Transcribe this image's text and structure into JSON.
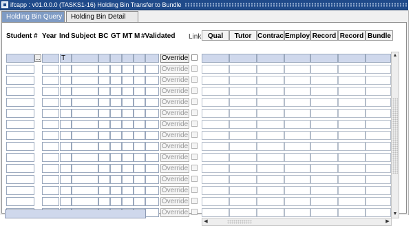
{
  "window": {
    "title": "ifcapp : v01.0.0.0 (TASKS1-16) Holding Bin Transfer to Bundle",
    "app_icon": "form-icon"
  },
  "tabs": [
    {
      "label": "Holding Bin Query",
      "active": true
    },
    {
      "label": "Holding Bin Detail",
      "active": false
    }
  ],
  "left_headers": {
    "student": "Student #",
    "year": "Year",
    "ind": "Ind",
    "subject": "Subject",
    "bc": "BC",
    "gt": "GT",
    "mt": "MT",
    "m": "M",
    "validated": "#Validated",
    "link": "Link"
  },
  "right_headers": [
    "Qual",
    "Tutor",
    "Contrac",
    "Employ",
    "Record",
    "Record",
    "Bundle"
  ],
  "rows": [
    {
      "student": "",
      "year": "",
      "ind": "T",
      "override": "Override",
      "override_enabled": true,
      "link": false
    },
    {
      "student": "",
      "year": "",
      "ind": "",
      "override": "Override",
      "override_enabled": false,
      "link": false
    },
    {
      "student": "",
      "year": "",
      "ind": "",
      "override": "Override",
      "override_enabled": false,
      "link": false
    },
    {
      "student": "",
      "year": "",
      "ind": "",
      "override": "Override",
      "override_enabled": false,
      "link": false
    },
    {
      "student": "",
      "year": "",
      "ind": "",
      "override": "Override",
      "override_enabled": false,
      "link": false
    },
    {
      "student": "",
      "year": "",
      "ind": "",
      "override": "Override",
      "override_enabled": false,
      "link": false
    },
    {
      "student": "",
      "year": "",
      "ind": "",
      "override": "Override",
      "override_enabled": false,
      "link": false
    },
    {
      "student": "",
      "year": "",
      "ind": "",
      "override": "Override",
      "override_enabled": false,
      "link": false
    },
    {
      "student": "",
      "year": "",
      "ind": "",
      "override": "Override",
      "override_enabled": false,
      "link": false
    },
    {
      "student": "",
      "year": "",
      "ind": "",
      "override": "Override",
      "override_enabled": false,
      "link": false
    },
    {
      "student": "",
      "year": "",
      "ind": "",
      "override": "Override",
      "override_enabled": false,
      "link": false
    },
    {
      "student": "",
      "year": "",
      "ind": "",
      "override": "Override",
      "override_enabled": false,
      "link": false
    },
    {
      "student": "",
      "year": "",
      "ind": "",
      "override": "Override",
      "override_enabled": false,
      "link": false
    },
    {
      "student": "",
      "year": "",
      "ind": "",
      "override": "Override",
      "override_enabled": false,
      "link": false
    },
    {
      "student": "",
      "year": "",
      "ind": "",
      "override": "Override",
      "override_enabled": false,
      "link": false
    }
  ],
  "student_lookup_label": "...",
  "scroll": {
    "up_icon": "▲",
    "down_icon": "▼",
    "left_icon": "◀",
    "right_icon": "▶"
  },
  "colors": {
    "title_bar": "#1f4a8a",
    "active_tab": "#7f9bc4",
    "selected_field": "#cfd8ec"
  }
}
